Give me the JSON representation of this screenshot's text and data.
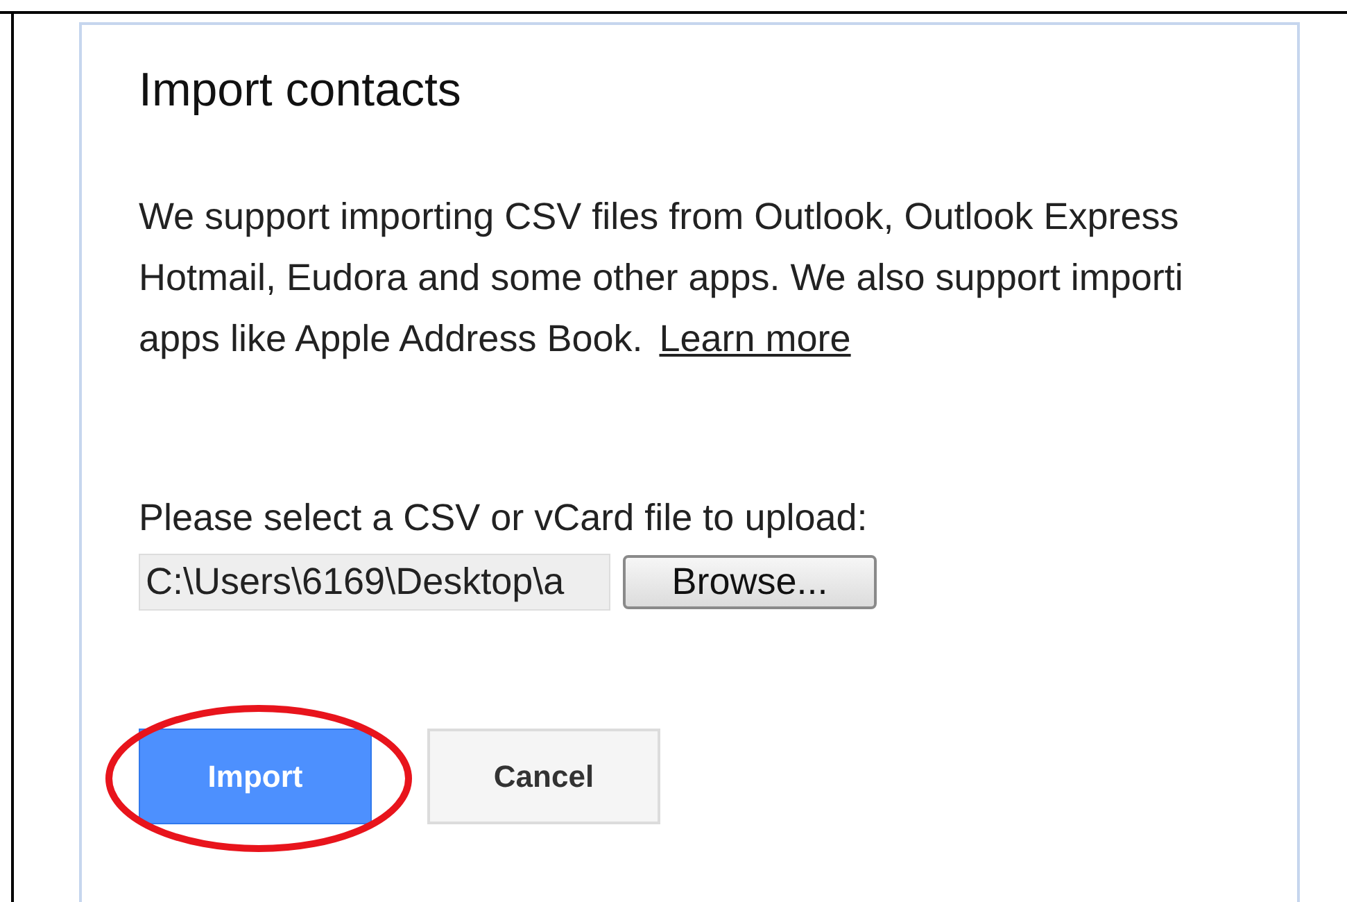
{
  "dialog": {
    "title": "Import contacts",
    "description_lines": [
      "We support importing CSV files from Outlook, Outlook Express",
      "Hotmail, Eudora and some other apps. We also support importi",
      "apps like Apple Address Book."
    ],
    "learn_more_link": "Learn more",
    "file_label": "Please select a CSV or vCard file to upload:",
    "file_field": {
      "value": "C:\\Users\\6169\\Desktop\\a"
    },
    "browse_button": "Browse...",
    "buttons": [
      {
        "label": "Import",
        "kind": "primary",
        "highlighted": true
      },
      {
        "label": "Cancel",
        "kind": "secondary",
        "highlighted": false
      }
    ]
  }
}
